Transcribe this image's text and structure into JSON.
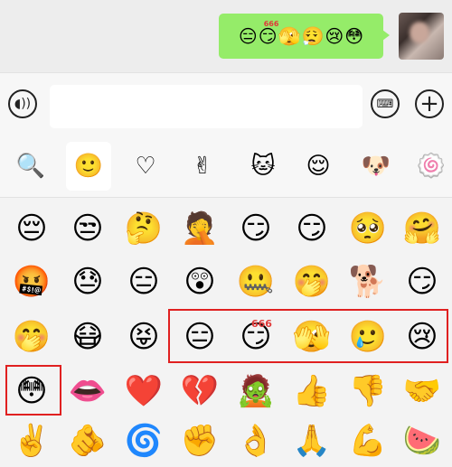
{
  "message": {
    "emojis": [
      "😑",
      "😏",
      "🫣",
      "😮‍💨",
      "😢",
      "😳"
    ],
    "badge_666": "666"
  },
  "input": {
    "placeholder": ""
  },
  "tabs": [
    {
      "name": "search",
      "glyph": "🔍"
    },
    {
      "name": "emoji",
      "glyph": "🙂"
    },
    {
      "name": "favorites",
      "glyph": "♡"
    },
    {
      "name": "gesture-sticker",
      "glyph": "✌"
    },
    {
      "name": "cat-sticker",
      "glyph": "🐱"
    },
    {
      "name": "face-sticker",
      "glyph": "😌"
    },
    {
      "name": "dog-sticker",
      "glyph": "🐶"
    },
    {
      "name": "pink-sticker",
      "glyph": "🍥"
    }
  ],
  "emoji_grid": [
    [
      "😔",
      "😒",
      "🤔",
      "🤦",
      "😏",
      "😏",
      "🥺",
      "🤗"
    ],
    [
      "🤬",
      "😓",
      "😑",
      "😲",
      "🤐",
      "🤭",
      "🐕",
      "😏"
    ],
    [
      "🤭",
      "😷",
      "😝",
      "😑",
      "😏",
      "🫣",
      "🥲",
      "😢"
    ],
    [
      "😳",
      "👄",
      "❤️",
      "💔",
      "🧟",
      "👍",
      "👎",
      "🤝"
    ],
    [
      "✌️",
      "🫵",
      "🌀",
      "✊",
      "👌",
      "🙏",
      "💪",
      "🍉"
    ]
  ],
  "badge_666": "666"
}
